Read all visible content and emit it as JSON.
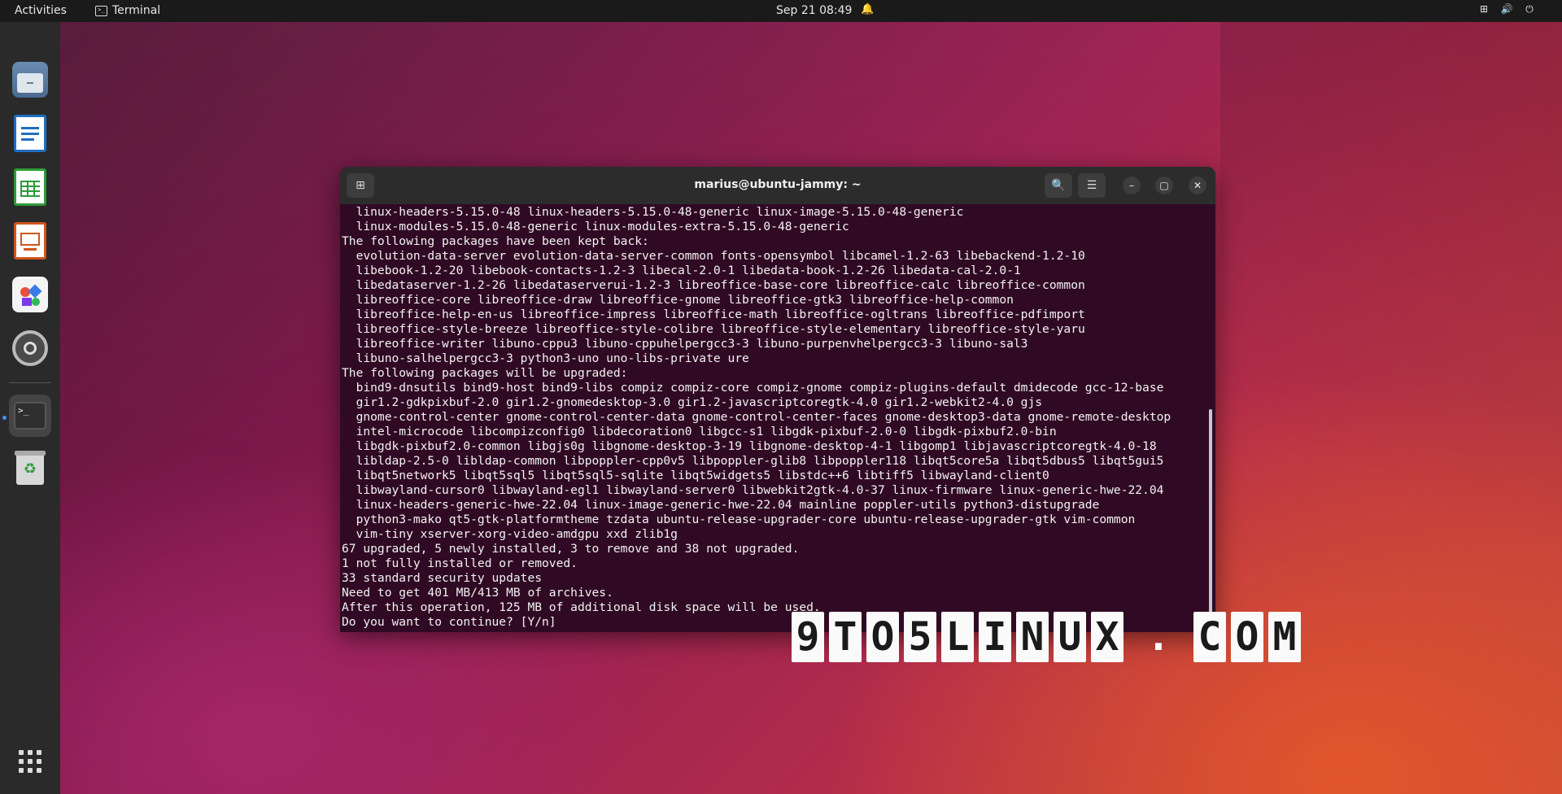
{
  "topbar": {
    "activities": "Activities",
    "app_name": "Terminal",
    "clock": "Sep 21  08:49"
  },
  "dock": {
    "items": [
      "files-icon",
      "writer-icon",
      "calc-icon",
      "impress-icon",
      "software-icon",
      "settings-icon",
      "terminal-icon",
      "trash-icon"
    ],
    "show_apps": "show-apps-icon"
  },
  "terminal": {
    "title": "marius@ubuntu-jammy: ~",
    "lines": [
      "  linux-headers-5.15.0-48 linux-headers-5.15.0-48-generic linux-image-5.15.0-48-generic",
      "  linux-modules-5.15.0-48-generic linux-modules-extra-5.15.0-48-generic",
      "The following packages have been kept back:",
      "  evolution-data-server evolution-data-server-common fonts-opensymbol libcamel-1.2-63 libebackend-1.2-10",
      "  libebook-1.2-20 libebook-contacts-1.2-3 libecal-2.0-1 libedata-book-1.2-26 libedata-cal-2.0-1",
      "  libedataserver-1.2-26 libedataserverui-1.2-3 libreoffice-base-core libreoffice-calc libreoffice-common",
      "  libreoffice-core libreoffice-draw libreoffice-gnome libreoffice-gtk3 libreoffice-help-common",
      "  libreoffice-help-en-us libreoffice-impress libreoffice-math libreoffice-ogltrans libreoffice-pdfimport",
      "  libreoffice-style-breeze libreoffice-style-colibre libreoffice-style-elementary libreoffice-style-yaru",
      "  libreoffice-writer libuno-cppu3 libuno-cppuhelpergcc3-3 libuno-purpenvhelpergcc3-3 libuno-sal3",
      "  libuno-salhelpergcc3-3 python3-uno uno-libs-private ure",
      "The following packages will be upgraded:",
      "  bind9-dnsutils bind9-host bind9-libs compiz compiz-core compiz-gnome compiz-plugins-default dmidecode gcc-12-base",
      "  gir1.2-gdkpixbuf-2.0 gir1.2-gnomedesktop-3.0 gir1.2-javascriptcoregtk-4.0 gir1.2-webkit2-4.0 gjs",
      "  gnome-control-center gnome-control-center-data gnome-control-center-faces gnome-desktop3-data gnome-remote-desktop",
      "  intel-microcode libcompizconfig0 libdecoration0 libgcc-s1 libgdk-pixbuf-2.0-0 libgdk-pixbuf2.0-bin",
      "  libgdk-pixbuf2.0-common libgjs0g libgnome-desktop-3-19 libgnome-desktop-4-1 libgomp1 libjavascriptcoregtk-4.0-18",
      "  libldap-2.5-0 libldap-common libpoppler-cpp0v5 libpoppler-glib8 libpoppler118 libqt5core5a libqt5dbus5 libqt5gui5",
      "  libqt5network5 libqt5sql5 libqt5sql5-sqlite libqt5widgets5 libstdc++6 libtiff5 libwayland-client0",
      "  libwayland-cursor0 libwayland-egl1 libwayland-server0 libwebkit2gtk-4.0-37 linux-firmware linux-generic-hwe-22.04",
      "  linux-headers-generic-hwe-22.04 linux-image-generic-hwe-22.04 mainline poppler-utils python3-distupgrade",
      "  python3-mako qt5-gtk-platformtheme tzdata ubuntu-release-upgrader-core ubuntu-release-upgrader-gtk vim-common",
      "  vim-tiny xserver-xorg-video-amdgpu xxd zlib1g",
      "67 upgraded, 5 newly installed, 3 to remove and 38 not upgraded.",
      "1 not fully installed or removed.",
      "33 standard security updates",
      "Need to get 401 MB/413 MB of archives.",
      "After this operation, 125 MB of additional disk space will be used.",
      "Do you want to continue? [Y/n]"
    ]
  },
  "watermark": {
    "chars": [
      "9",
      "T",
      "O",
      "5",
      "L",
      "I",
      "N",
      "U",
      "X",
      "",
      ".",
      "",
      "C",
      "O",
      "M"
    ]
  }
}
